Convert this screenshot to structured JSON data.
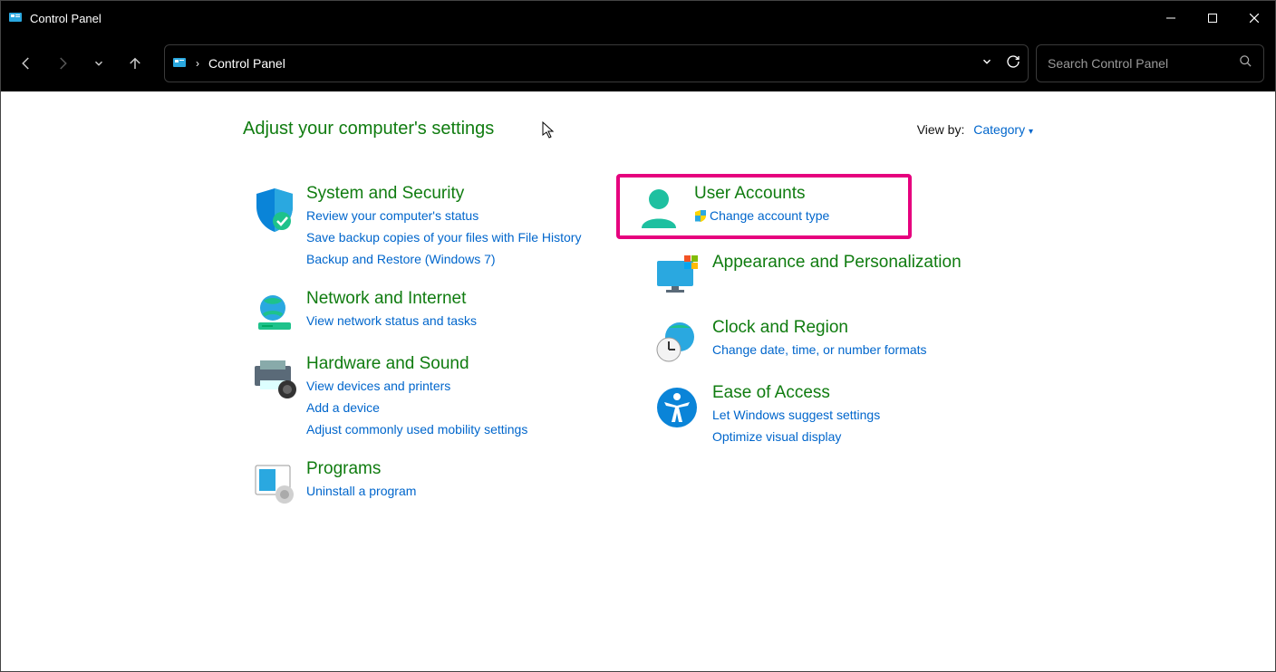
{
  "window": {
    "title": "Control Panel"
  },
  "addressbar": {
    "path": "Control Panel"
  },
  "search": {
    "placeholder": "Search Control Panel"
  },
  "header": {
    "adjust": "Adjust your computer's settings",
    "viewby_label": "View by:",
    "viewby_value": "Category"
  },
  "categories": {
    "system": {
      "title": "System and Security",
      "links": [
        "Review your computer's status",
        "Save backup copies of your files with File History",
        "Backup and Restore (Windows 7)"
      ]
    },
    "network": {
      "title": "Network and Internet",
      "links": [
        "View network status and tasks"
      ]
    },
    "hardware": {
      "title": "Hardware and Sound",
      "links": [
        "View devices and printers",
        "Add a device",
        "Adjust commonly used mobility settings"
      ]
    },
    "programs": {
      "title": "Programs",
      "links": [
        "Uninstall a program"
      ]
    },
    "user": {
      "title": "User Accounts",
      "links": [
        "Change account type"
      ]
    },
    "appearance": {
      "title": "Appearance and Personalization"
    },
    "clock": {
      "title": "Clock and Region",
      "links": [
        "Change date, time, or number formats"
      ]
    },
    "ease": {
      "title": "Ease of Access",
      "links": [
        "Let Windows suggest settings",
        "Optimize visual display"
      ]
    }
  }
}
